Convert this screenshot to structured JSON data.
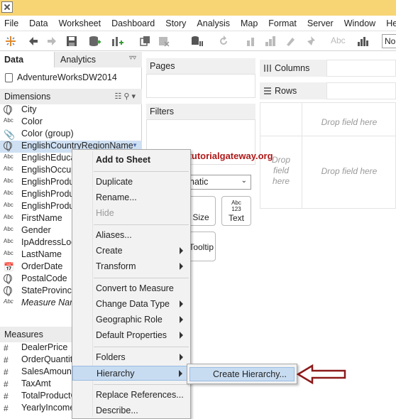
{
  "menubar": [
    "File",
    "Data",
    "Worksheet",
    "Dashboard",
    "Story",
    "Analysis",
    "Map",
    "Format",
    "Server",
    "Window",
    "Help"
  ],
  "toolbar": {
    "abc_label": "Abc",
    "fit_value": "No"
  },
  "left_pane": {
    "tabs": {
      "data": "Data",
      "analytics": "Analytics"
    },
    "datasource": "AdventureWorksDW2014",
    "dimensions_title": "Dimensions",
    "dimensions": [
      {
        "icon": "globe",
        "label": "City"
      },
      {
        "icon": "abc",
        "label": "Color"
      },
      {
        "icon": "paperclip",
        "label": "Color (group)"
      },
      {
        "icon": "globe",
        "label": "EnglishCountryRegionName",
        "selected": true
      },
      {
        "icon": "abc",
        "label": "EnglishEduca"
      },
      {
        "icon": "abc",
        "label": "EnglishOccup"
      },
      {
        "icon": "abc",
        "label": "EnglishProdu"
      },
      {
        "icon": "abc",
        "label": "EnglishProdu"
      },
      {
        "icon": "abc",
        "label": "EnglishProdu"
      },
      {
        "icon": "abc",
        "label": "FirstName"
      },
      {
        "icon": "abc",
        "label": "Gender"
      },
      {
        "icon": "abc",
        "label": "IpAddressLoc"
      },
      {
        "icon": "abc",
        "label": "LastName"
      },
      {
        "icon": "date",
        "label": "OrderDate"
      },
      {
        "icon": "globe",
        "label": "PostalCode"
      },
      {
        "icon": "globe",
        "label": "StateProvince"
      },
      {
        "icon": "abc",
        "label": "Measure Nan",
        "italic": true
      }
    ],
    "measures_title": "Measures",
    "measures": [
      {
        "icon": "#",
        "label": "DealerPrice"
      },
      {
        "icon": "#",
        "label": "OrderQuantit"
      },
      {
        "icon": "#",
        "label": "SalesAmount"
      },
      {
        "icon": "#",
        "label": "TaxAmt"
      },
      {
        "icon": "#",
        "label": "TotalProductC"
      },
      {
        "icon": "#",
        "label": "YearlyIncome"
      }
    ]
  },
  "shelves": {
    "pages": "Pages",
    "filters": "Filters",
    "columns": "Columns",
    "rows": "Rows",
    "marks_type": "natic",
    "marks_buttons": [
      {
        "name": "size",
        "label": "Size"
      },
      {
        "name": "text",
        "label": "Text",
        "icon_text": "Abc 123"
      },
      {
        "name": "tooltip",
        "label": "Tooltip"
      }
    ]
  },
  "view": {
    "drop_field_here": "Drop field here",
    "drop_left": [
      "Drop",
      "field",
      "here"
    ]
  },
  "watermark": "©tutorialgateway.org",
  "context_menu": [
    {
      "label": "Add to Sheet",
      "bold": true
    },
    {
      "sep": true
    },
    {
      "label": "Duplicate"
    },
    {
      "label": "Rename..."
    },
    {
      "label": "Hide",
      "disabled": true
    },
    {
      "sep": true
    },
    {
      "label": "Aliases..."
    },
    {
      "label": "Create",
      "submenu": true
    },
    {
      "label": "Transform",
      "submenu": true
    },
    {
      "sep": true
    },
    {
      "label": "Convert to Measure"
    },
    {
      "label": "Change Data Type",
      "submenu": true
    },
    {
      "label": "Geographic Role",
      "submenu": true
    },
    {
      "label": "Default Properties",
      "submenu": true
    },
    {
      "sep": true
    },
    {
      "label": "Folders",
      "submenu": true
    },
    {
      "label": "Hierarchy",
      "submenu": true,
      "highlighted": true
    },
    {
      "sep": true
    },
    {
      "label": "Replace References..."
    },
    {
      "label": "Describe..."
    }
  ],
  "hierarchy_submenu": {
    "item": "Create Hierarchy..."
  },
  "colors": {
    "title_strip": "#f7d575",
    "highlight": "#c8dcf1",
    "watermark": "#b01818",
    "arrow": "#8b1a1a"
  }
}
